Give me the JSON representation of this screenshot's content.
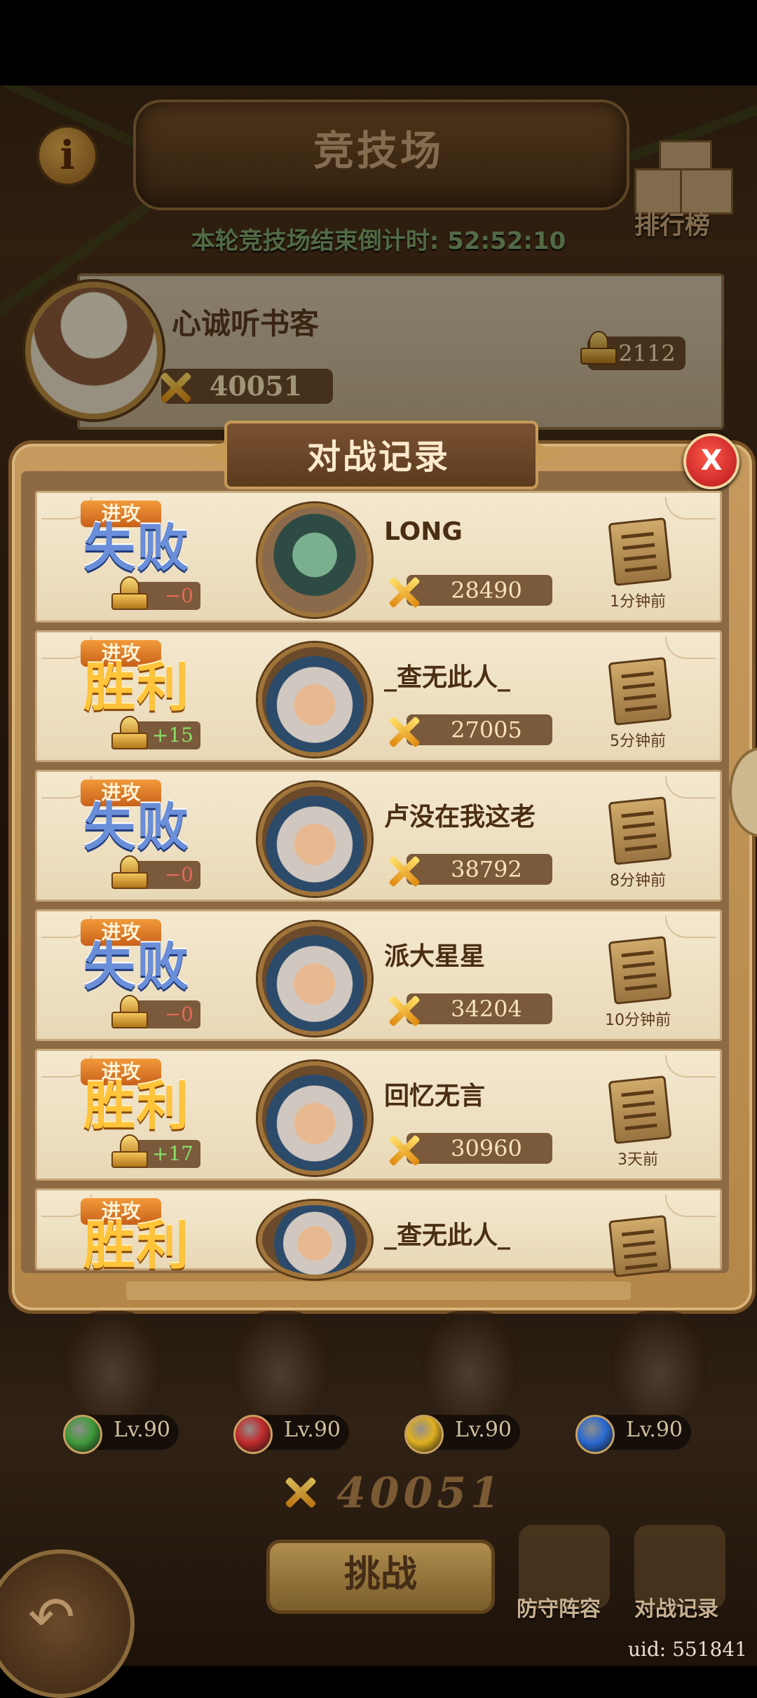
{
  "header": {
    "title": "竞技场",
    "rank_label": "排行榜",
    "countdown": "本轮竞技场结束倒计时: 52:52:10"
  },
  "player": {
    "name": "心诚听书客",
    "power": "40051",
    "trophies": "2112"
  },
  "modal": {
    "title": "对战记录",
    "close_label": "X",
    "records": [
      {
        "tag": "进攻",
        "result": "失败",
        "score": "−0",
        "name": "LONG",
        "power": "28490",
        "time": "1分钟前"
      },
      {
        "tag": "进攻",
        "result": "胜利",
        "score": "+15",
        "name": "_查无此人_",
        "power": "27005",
        "time": "5分钟前"
      },
      {
        "tag": "进攻",
        "result": "失败",
        "score": "−0",
        "name": "卢没在我这老",
        "power": "38792",
        "time": "8分钟前"
      },
      {
        "tag": "进攻",
        "result": "失败",
        "score": "−0",
        "name": "派大星星",
        "power": "34204",
        "time": "10分钟前"
      },
      {
        "tag": "进攻",
        "result": "胜利",
        "score": "+17",
        "name": "回忆无言",
        "power": "30960",
        "time": "3天前"
      },
      {
        "tag": "进攻",
        "result": "胜利",
        "score": "",
        "name": "_查无此人_",
        "power": "",
        "time": ""
      }
    ]
  },
  "team": {
    "levels": [
      "Lv.90",
      "Lv.90",
      "Lv.90",
      "Lv.90"
    ],
    "gem_colors": [
      "#3f9a3a",
      "#c02a2a",
      "#e0b020",
      "#2a6ad0"
    ],
    "power": "40051"
  },
  "actions": {
    "challenge": "挑战",
    "defense": "防守阵容",
    "battle_log": "对战记录"
  },
  "uid": "uid: 551841"
}
